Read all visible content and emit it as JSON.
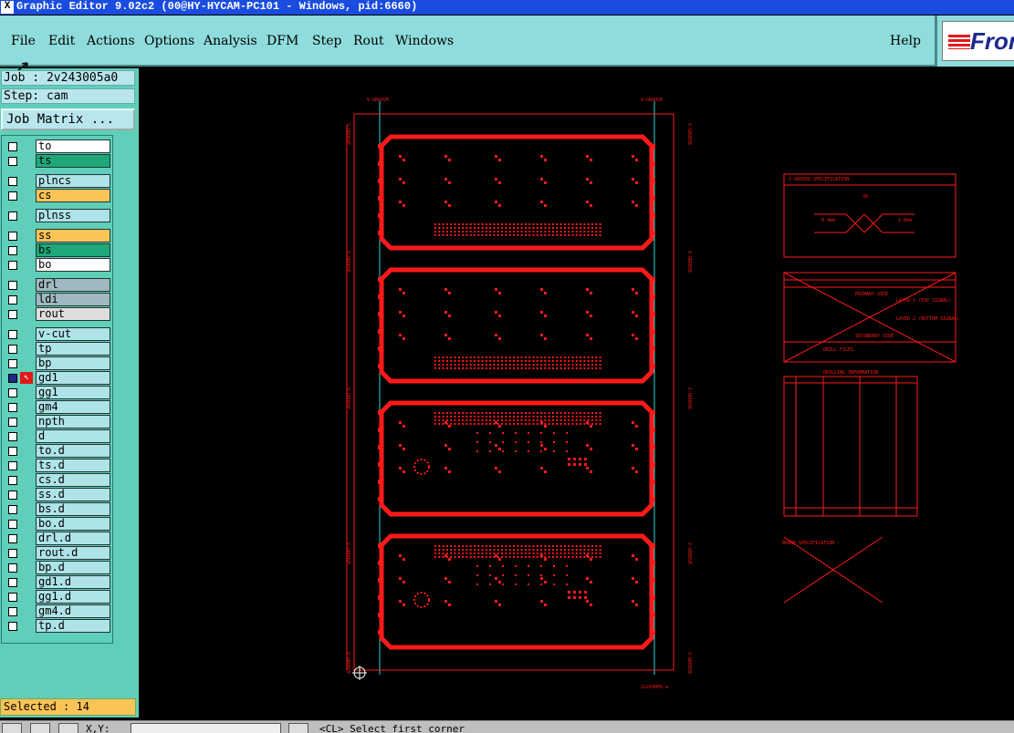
{
  "window": {
    "title": "Graphic Editor 9.02c2 (00@HY-HYCAM-PC101 - Windows, pid:6660)",
    "close_glyph": "X"
  },
  "menu": {
    "items": [
      "File",
      "Edit",
      "Actions",
      "Options",
      "Analysis",
      "DFM",
      "Step",
      "Rout",
      "Windows"
    ],
    "help": "Help"
  },
  "logo": {
    "text": "Fron"
  },
  "job": {
    "label": "Job : 2v243005a0",
    "step": "Step: cam",
    "matrix_button": "Job Matrix ..."
  },
  "layers": [
    {
      "name": "to",
      "color": "white"
    },
    {
      "name": "ts",
      "color": "green"
    },
    {
      "name": "plncs",
      "color": "cyan"
    },
    {
      "name": "cs",
      "color": "orange"
    },
    {
      "name": "plnss",
      "color": "cyan"
    },
    {
      "name": "ss",
      "color": "orange"
    },
    {
      "name": "bs",
      "color": "green"
    },
    {
      "name": "bo",
      "color": "white"
    },
    {
      "name": "drl",
      "color": "gray"
    },
    {
      "name": "ldi",
      "color": "gray"
    },
    {
      "name": "rout",
      "color": "light"
    },
    {
      "name": "v-cut",
      "color": "cyan"
    },
    {
      "name": "tp",
      "color": "cyan"
    },
    {
      "name": "bp",
      "color": "cyan"
    },
    {
      "name": "gd1",
      "color": "cyan"
    },
    {
      "name": "gg1",
      "color": "cyan"
    },
    {
      "name": "gm4",
      "color": "cyan"
    },
    {
      "name": "npth",
      "color": "cyan"
    },
    {
      "name": "d",
      "color": "cyan"
    },
    {
      "name": "to.d",
      "color": "cyan"
    },
    {
      "name": "ts.d",
      "color": "cyan"
    },
    {
      "name": "cs.d",
      "color": "cyan"
    },
    {
      "name": "ss.d",
      "color": "cyan"
    },
    {
      "name": "bs.d",
      "color": "cyan"
    },
    {
      "name": "bo.d",
      "color": "cyan"
    },
    {
      "name": "drl.d",
      "color": "cyan"
    },
    {
      "name": "rout.d",
      "color": "cyan"
    },
    {
      "name": "bp.d",
      "color": "cyan"
    },
    {
      "name": "gd1.d",
      "color": "cyan"
    },
    {
      "name": "gg1.d",
      "color": "cyan"
    },
    {
      "name": "gm4.d",
      "color": "cyan"
    },
    {
      "name": "tp.d",
      "color": "cyan"
    }
  ],
  "status": {
    "selected": "Selected : 14",
    "xy_label": "X,Y:",
    "prompt": "<CL>   Select first corner"
  },
  "drawing": {
    "vgroove_label": "V-GROOVE",
    "spec_title": "V-GROOVE SPECIFICATION",
    "spec_angle": "30",
    "spec_left": "0.4mm",
    "spec_right": "1.6mm",
    "stack_primary": "PRIMARY SIDE",
    "stack_secondary": "SECONDARY SIDE",
    "stack_layer1": "LAYER 1 (TOP SIGNAL)",
    "stack_layer2": "LAYER 2 (BOTTOM SIGNAL)",
    "drill_files": "DRILL FILES",
    "drill_title": "DRILLING INFORMATION",
    "board_title": "BOARD SPECIFICATION :",
    "bottom_label": "2v243005-a"
  },
  "colors": {
    "accent": "#ff1a1a",
    "cyan_line": "#2ad4d4",
    "menubar": "#8fdcdc",
    "panel": "#60cfb9"
  }
}
